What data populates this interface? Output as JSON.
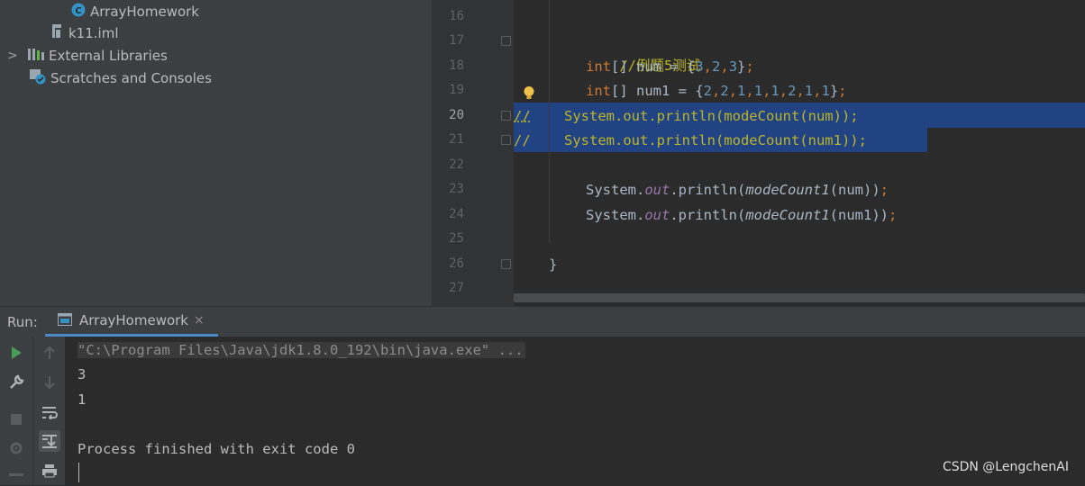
{
  "project_tree": {
    "items": [
      {
        "label": "ArrayHomework",
        "icon": "java-class-icon"
      },
      {
        "label": "k11.iml",
        "icon": "module-file-icon"
      },
      {
        "label": "External Libraries",
        "icon": "libraries-icon",
        "expand": ">"
      },
      {
        "label": "Scratches and Consoles",
        "icon": "scratches-icon"
      }
    ]
  },
  "editor": {
    "line_numbers": [
      "16",
      "17",
      "18",
      "19",
      "20",
      "21",
      "22",
      "23",
      "24",
      "25",
      "26",
      "27"
    ],
    "current_line": "20",
    "code": {
      "l17_comment": "//例题5测试",
      "l18": {
        "kw": "int",
        "rest_a": "[] num = {",
        "n1": "3",
        "c1": ",",
        "n2": "2",
        "c2": ",",
        "n3": "3",
        "end": "}",
        "semi": ";"
      },
      "l19": {
        "kw": "int",
        "rest_a": "[] num1 = {",
        "n1": "2",
        "n2": "2",
        "n3": "1",
        "n4": "1",
        "n5": "1",
        "n6": "2",
        "n7": "1",
        "n8": "1",
        "comma": ",",
        "end": "}",
        "semi": ";"
      },
      "l20_prefix": "//",
      "l20_text": "    System.out.println(modeCount(num));",
      "l21_prefix": "//",
      "l21_text": "    System.out.println(modeCount(num1));",
      "l23": {
        "a": "System.",
        "out": "out",
        "b": ".println(",
        "fn": "modeCount1",
        "c": "(num))",
        "semi": ";"
      },
      "l24": {
        "a": "System.",
        "out": "out",
        "b": ".println(",
        "fn": "modeCount1",
        "c": "(num1))",
        "semi": ";"
      },
      "l26": "}"
    }
  },
  "run": {
    "label": "Run:",
    "tab_label": "ArrayHomework",
    "close_glyph": "×"
  },
  "console": {
    "command": "\"C:\\Program Files\\Java\\jdk1.8.0_192\\bin\\java.exe\" ...",
    "out1": "3",
    "out2": "1",
    "finished": "Process finished with exit code 0"
  },
  "watermark": "CSDN @LengchenAI",
  "colors": {
    "selection": "#214283",
    "keyword": "#cc7832",
    "number": "#6897bb",
    "comment": "#bbb529",
    "field": "#9876aa",
    "run_green": "#499c54"
  }
}
